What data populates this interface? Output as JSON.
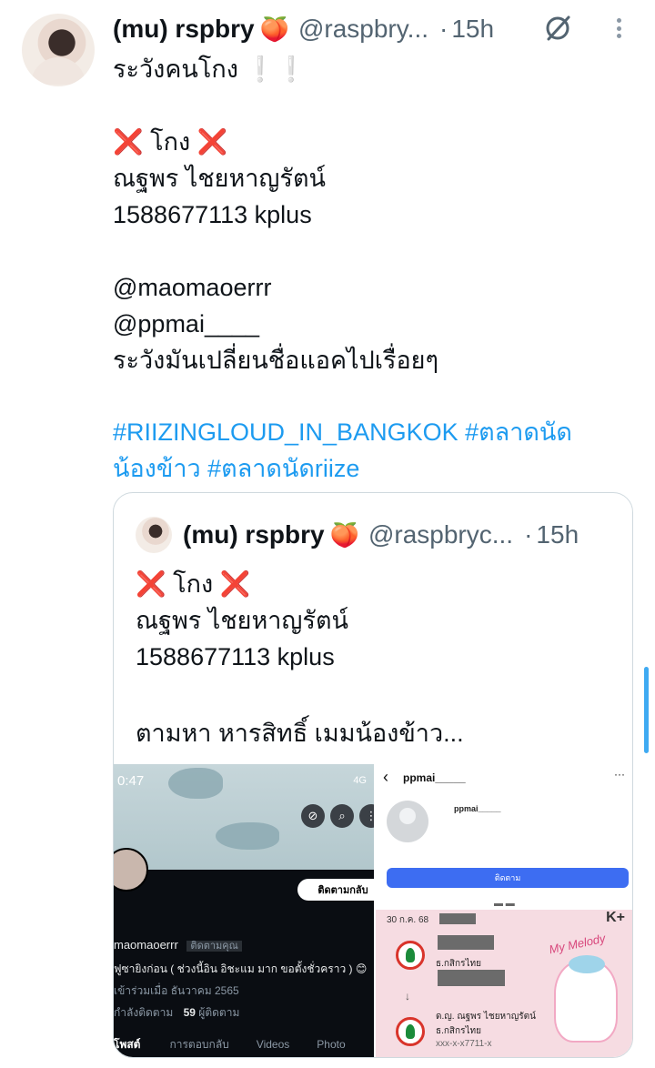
{
  "tweet": {
    "author_name": "(mu) rspbry",
    "author_emoji": "🍑",
    "handle": "@raspbry...",
    "separator": "·",
    "time": "15h",
    "lines": [
      "ระวังคนโกง ❕❕",
      "",
      "❌ โกง ❌",
      "ณฐพร ไชยหาญรัตน์",
      "1588677113 kplus",
      "",
      "@maomaoerrr",
      "@ppmai____",
      "ระวังมันเปลี่ยนชื่อแอคไปเรื่อยๆ",
      ""
    ],
    "hashtags_line1": "#RIIZINGLOUD_IN_BANGKOK #ตลาดนัด",
    "hashtags_line2": "น้องข้าว #ตลาดนัดriize"
  },
  "quote": {
    "author_name": "(mu) rspbry",
    "author_emoji": "🍑",
    "handle": "@raspbryc...",
    "separator": "·",
    "time": "15h",
    "lines": [
      "❌ โกง ❌",
      "ณฐพร ไชยหาญรัตน์",
      "1588677113 kplus",
      "",
      "ตามหา หารสิทธิ์ เมมน้องข้าว..."
    ],
    "media_left": {
      "status_time": "0:47",
      "status_right": "4G",
      "follow_label": "ติดตามกลับ",
      "username": "maomaoerrr",
      "follows_you": "ติดตามคุณ",
      "bio": "ฟูซายิงก่อน ( ช่วงนี้อิน อิชะแม มาก ขอตั้งชั่วคราว ) 😊",
      "joined": "เข้าร่วมเมื่อ ธันวาคม 2565",
      "following_label": "กำลังติดตาม",
      "followers_count": "59",
      "followers_label": "ผู้ติดตาม",
      "tabs": [
        "โพสต์",
        "การตอบกลับ",
        "Videos",
        "Photo"
      ]
    },
    "media_right": {
      "back": "‹",
      "username": "ppmai_____",
      "profile_name": "ppmai_____",
      "menu": "···",
      "follow_label": "ติดตาม",
      "pager": "▬ ▬",
      "date": "30 ก.ค. 68",
      "kplus": "K+",
      "bank1": "ธ.กสิกรไทย",
      "recipient": "ด.ญ. ณฐพร ไชยหาญรัตน์",
      "bank2": "ธ.กสิกรไทย",
      "acct": "xxx-x-x7711-x",
      "melody": "My Melody"
    }
  },
  "colors": {
    "link": "#1d9bf0",
    "text": "#0f1419",
    "muted": "#536471",
    "border": "#cfd9de",
    "x_mark": "#e03131"
  }
}
